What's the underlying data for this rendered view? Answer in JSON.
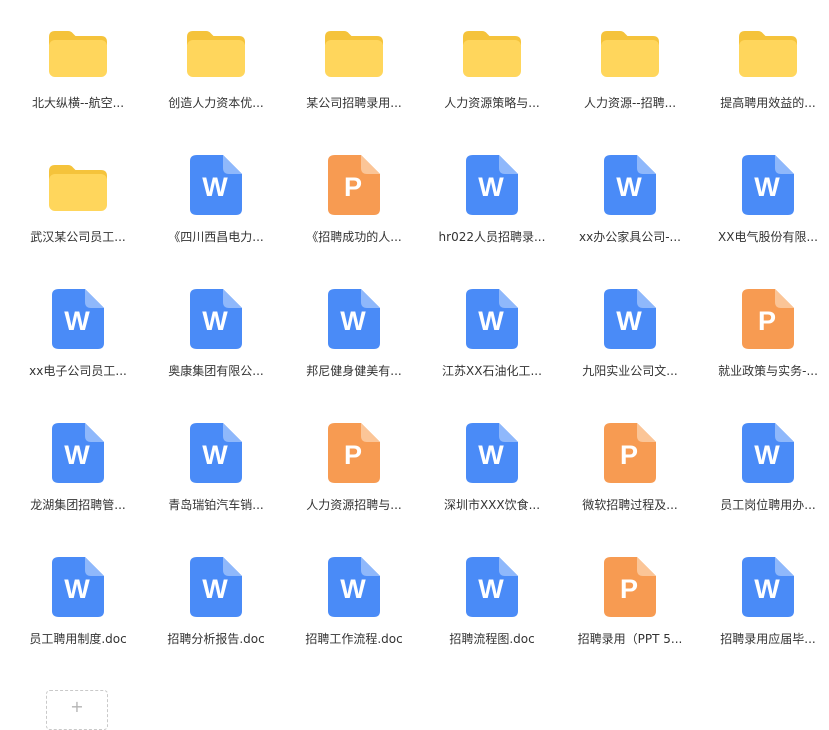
{
  "colors": {
    "folder_back": "#F5C33B",
    "folder_front": "#FFD65C",
    "word_body": "#4A8BF7",
    "word_fold": "#8FB8FB",
    "ppt_body": "#F79B52",
    "ppt_fold": "#FBC597",
    "label_text": "#333333"
  },
  "files": [
    {
      "type": "folder",
      "icon": "folder-icon",
      "name": "北大纵横--航空..."
    },
    {
      "type": "folder",
      "icon": "folder-icon",
      "name": "创造人力资本优..."
    },
    {
      "type": "folder",
      "icon": "folder-icon",
      "name": "某公司招聘录用..."
    },
    {
      "type": "folder",
      "icon": "folder-icon",
      "name": "人力资源策略与..."
    },
    {
      "type": "folder",
      "icon": "folder-icon",
      "name": "人力资源--招聘..."
    },
    {
      "type": "folder",
      "icon": "folder-icon",
      "name": "提高聘用效益的..."
    },
    {
      "type": "folder",
      "icon": "folder-icon",
      "name": "武汉某公司员工..."
    },
    {
      "type": "word",
      "icon": "word-doc-icon",
      "glyph": "W",
      "name": "《四川西昌电力..."
    },
    {
      "type": "ppt",
      "icon": "ppt-doc-icon",
      "glyph": "P",
      "name": "《招聘成功的人..."
    },
    {
      "type": "word",
      "icon": "word-doc-icon",
      "glyph": "W",
      "name": "hr022人员招聘录..."
    },
    {
      "type": "word",
      "icon": "word-doc-icon",
      "glyph": "W",
      "name": "xx办公家具公司-..."
    },
    {
      "type": "word",
      "icon": "word-doc-icon",
      "glyph": "W",
      "name": "XX电气股份有限..."
    },
    {
      "type": "word",
      "icon": "word-doc-icon",
      "glyph": "W",
      "name": "xx电子公司员工..."
    },
    {
      "type": "word",
      "icon": "word-doc-icon",
      "glyph": "W",
      "name": "奥康集团有限公..."
    },
    {
      "type": "word",
      "icon": "word-doc-icon",
      "glyph": "W",
      "name": "邦尼健身健美有..."
    },
    {
      "type": "word",
      "icon": "word-doc-icon",
      "glyph": "W",
      "name": "江苏XX石油化工..."
    },
    {
      "type": "word",
      "icon": "word-doc-icon",
      "glyph": "W",
      "name": "九阳实业公司文..."
    },
    {
      "type": "ppt",
      "icon": "ppt-doc-icon",
      "glyph": "P",
      "name": "就业政策与实务-..."
    },
    {
      "type": "word",
      "icon": "word-doc-icon",
      "glyph": "W",
      "name": "龙湖集团招聘管..."
    },
    {
      "type": "word",
      "icon": "word-doc-icon",
      "glyph": "W",
      "name": "青岛瑞铂汽车销..."
    },
    {
      "type": "ppt",
      "icon": "ppt-doc-icon",
      "glyph": "P",
      "name": "人力资源招聘与..."
    },
    {
      "type": "word",
      "icon": "word-doc-icon",
      "glyph": "W",
      "name": "深圳市XXX饮食..."
    },
    {
      "type": "ppt",
      "icon": "ppt-doc-icon",
      "glyph": "P",
      "name": "微软招聘过程及..."
    },
    {
      "type": "word",
      "icon": "word-doc-icon",
      "glyph": "W",
      "name": "员工岗位聘用办..."
    },
    {
      "type": "word",
      "icon": "word-doc-icon",
      "glyph": "W",
      "name": "员工聘用制度.doc"
    },
    {
      "type": "word",
      "icon": "word-doc-icon",
      "glyph": "W",
      "name": "招聘分析报告.doc"
    },
    {
      "type": "word",
      "icon": "word-doc-icon",
      "glyph": "W",
      "name": "招聘工作流程.doc"
    },
    {
      "type": "word",
      "icon": "word-doc-icon",
      "glyph": "W",
      "name": "招聘流程图.doc"
    },
    {
      "type": "ppt",
      "icon": "ppt-doc-icon",
      "glyph": "P",
      "name": "招聘录用（PPT 5..."
    },
    {
      "type": "word",
      "icon": "word-doc-icon",
      "glyph": "W",
      "name": "招聘录用应届毕..."
    }
  ],
  "add_tile": {
    "icon": "plus-icon",
    "glyph": "+"
  }
}
